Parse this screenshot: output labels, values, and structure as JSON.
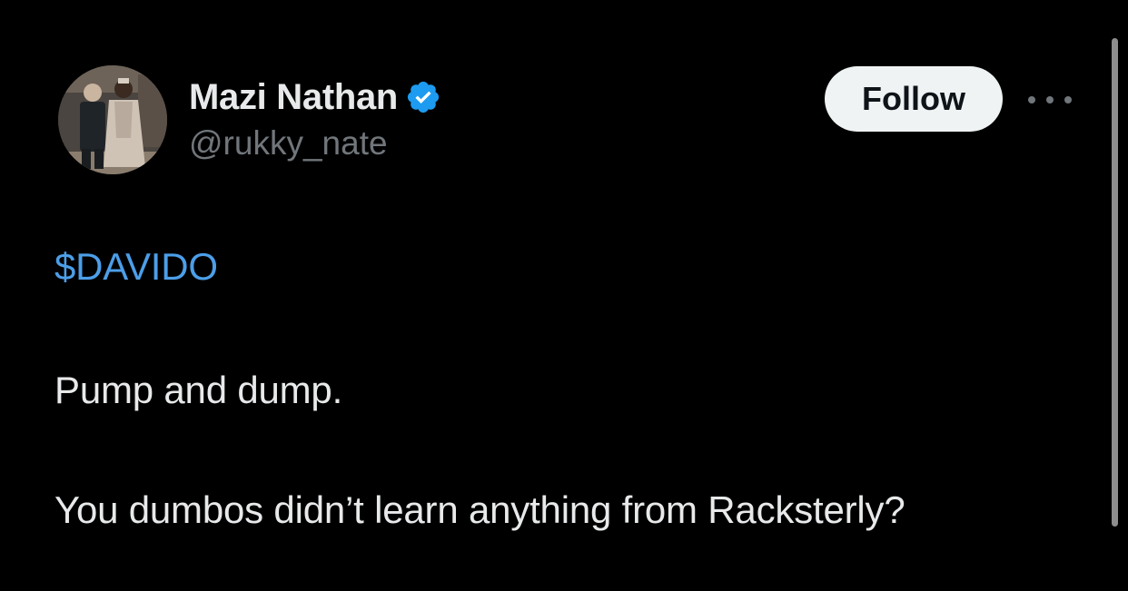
{
  "author": {
    "display_name": "Mazi Nathan",
    "handle": "@rukky_nate",
    "verified": true,
    "avatar_icon": "profile-photo-avatar"
  },
  "actions": {
    "follow_label": "Follow",
    "more_icon": "more-horizontal-icon"
  },
  "tweet": {
    "cashtag": "$DAVIDO",
    "line_1": "Pump and dump.",
    "line_2": "You dumbos didn’t learn anything from Racksterly?"
  },
  "colors": {
    "background": "#000000",
    "link": "#4c9ee8",
    "verified_badge": "#1d9bf0",
    "secondary_text": "#71767b",
    "follow_button_bg": "#eff3f4"
  }
}
